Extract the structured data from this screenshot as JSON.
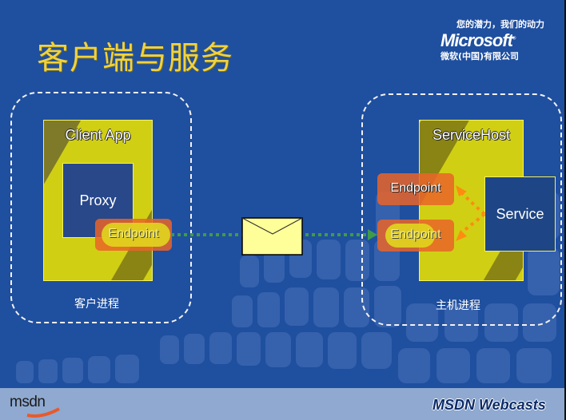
{
  "slide": {
    "title": "客户端与服务",
    "slogan": "您的潜力，我们的动力",
    "brand": "Microsoft",
    "brand_cn": "微软(中国)有限公司",
    "footer_left": "msdn",
    "footer_right": "MSDN Webcasts"
  },
  "client_process": {
    "label": "客户进程",
    "app_label": "Client App",
    "proxy_label": "Proxy",
    "endpoint_label": "Endpoint"
  },
  "host_process": {
    "label": "主机进程",
    "host_label": "ServiceHost",
    "endpoints": [
      "Endpoint",
      "Endpoint"
    ],
    "service_label": "Service"
  },
  "message": {
    "icon": "envelope-icon"
  },
  "colors": {
    "background": "#1f4f9f",
    "title": "#f2d23c",
    "box_yellow": "#d0cf14",
    "endpoint_orange": "#ea6428",
    "connector_green": "#3f9b4a",
    "arrow_orange": "#ff8c10",
    "envelope": "#ffff99"
  }
}
